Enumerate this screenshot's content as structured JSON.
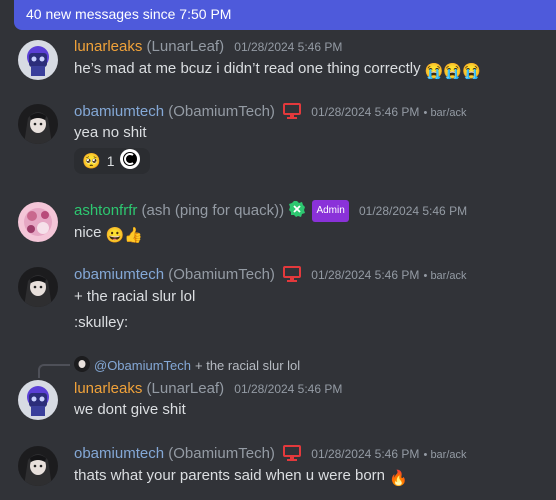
{
  "banner": {
    "text": "40 new messages since 7:50 PM"
  },
  "messages": [
    {
      "username": "lunarleaks",
      "display_name": "(LunarLeaf)",
      "timestamp": "01/28/2024 5:46 PM",
      "text": "he’s mad at me bcuz i didn’t read one thing correctly",
      "emoji": "😭😭😭",
      "name_color": "#f0a23a"
    },
    {
      "username": "obamiumtech",
      "display_name": "(ObamiumTech)",
      "timestamp": "01/28/2024 5:46 PM",
      "suffix": "• bar/ack",
      "text": "yea no shit",
      "reaction": {
        "emoji": "🥺",
        "count": "1"
      },
      "name_color": "#84a8d6"
    },
    {
      "username": "ashtonfrfr",
      "display_name": "(ash (ping for quack))",
      "badge": "Admin",
      "timestamp": "01/28/2024 5:46 PM",
      "text": "nice",
      "emoji": "😀👍",
      "name_color": "#2dc770"
    },
    {
      "username": "obamiumtech",
      "display_name": "(ObamiumTech)",
      "timestamp": "01/28/2024 5:46 PM",
      "suffix": "• bar/ack",
      "text": "+ the racial slur lol",
      "text2": ":skulley:",
      "name_color": "#84a8d6"
    },
    {
      "reply": {
        "mention": "@ObamiumTech",
        "text": "+ the racial slur lol"
      },
      "username": "lunarleaks",
      "display_name": "(LunarLeaf)",
      "timestamp": "01/28/2024 5:46 PM",
      "text": "we dont give shit",
      "name_color": "#f0a23a"
    },
    {
      "username": "obamiumtech",
      "display_name": "(ObamiumTech)",
      "timestamp": "01/28/2024 5:46 PM",
      "suffix": "• bar/ack",
      "text": "thats what your parents said when u were born",
      "emoji": "🔥",
      "name_color": "#84a8d6"
    }
  ],
  "colors": {
    "accent": "#4e5adb",
    "admin_badge": "#8a32d9",
    "monitor_icon": "#e3393c"
  }
}
